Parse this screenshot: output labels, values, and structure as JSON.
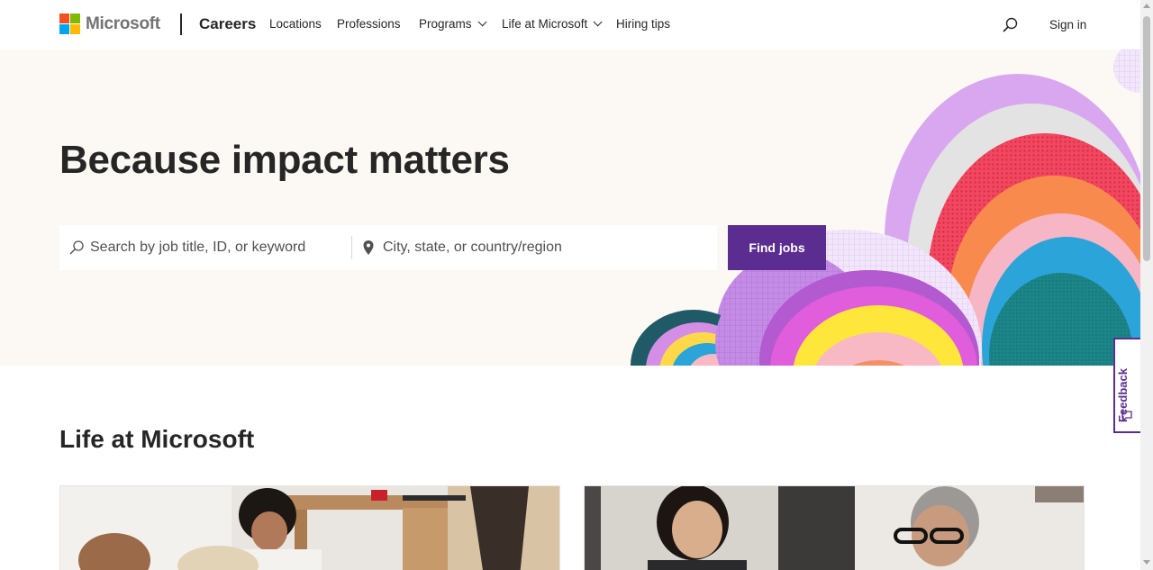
{
  "brand": {
    "name": "Microsoft",
    "section": "Careers",
    "logo_colors": [
      "#f25022",
      "#7fba00",
      "#00a4ef",
      "#ffb900"
    ]
  },
  "nav": {
    "items": [
      {
        "label": "Locations",
        "has_dropdown": false
      },
      {
        "label": "Professions",
        "has_dropdown": false
      },
      {
        "label": "Programs",
        "has_dropdown": true
      },
      {
        "label": "Life at Microsoft",
        "has_dropdown": true
      },
      {
        "label": "Hiring tips",
        "has_dropdown": false
      }
    ],
    "search_icon": "search-icon",
    "signin_label": "Sign in"
  },
  "hero": {
    "title": "Because impact matters",
    "keyword_placeholder": "Search by job title, ID, or keyword",
    "location_placeholder": "City, state, or country/region",
    "find_label": "Find jobs",
    "background_color": "#fcf8f3",
    "accent_color": "#5c2d91"
  },
  "feedback": {
    "label": "Feedback"
  },
  "life": {
    "title": "Life at Microsoft",
    "cards": [
      {
        "image": "person-at-desk-with-dog-photo"
      },
      {
        "image": "colleagues-at-laptop-photo"
      }
    ]
  }
}
